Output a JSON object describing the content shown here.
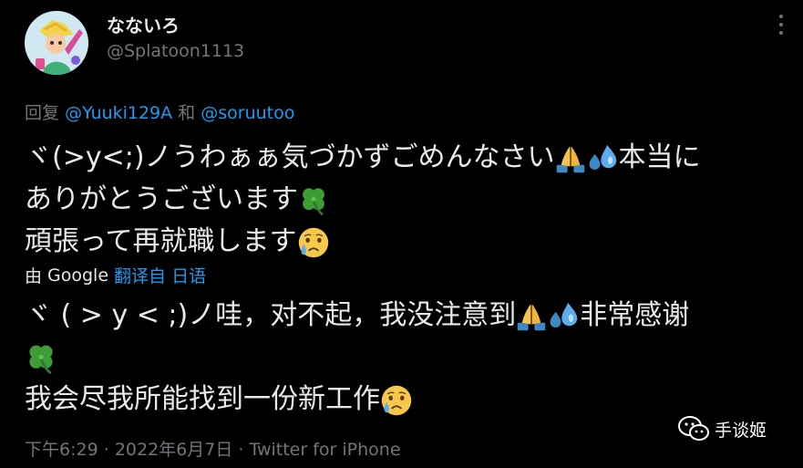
{
  "author": {
    "display_name": "なないろ",
    "handle": "@Splatoon1113"
  },
  "reply": {
    "prefix": "回复",
    "mention1": "@Yuuki129A",
    "conjunction": "和",
    "mention2": "@soruutoo"
  },
  "tweet": {
    "line1_a": "ヾ(>y<;)ノうわぁぁ気づかずごめんなさい",
    "line1_b": "本当に",
    "line2": "ありがとうございます",
    "line3": "頑張って再就職します"
  },
  "translation": {
    "by": "由",
    "google": "Google",
    "translated_from": "翻译自 日语",
    "line1_a": "ヾ ( > y < ;)ノ哇，对不起，我没注意到",
    "line1_b": "非常感谢",
    "line3": "我会尽我所能找到一份新工作"
  },
  "meta": {
    "time": "下午6:29",
    "separator1": "·",
    "date": "2022年6月7日",
    "separator2": "·",
    "source": "Twitter for iPhone"
  },
  "watermark": {
    "label": "手谈姬"
  },
  "icons": {
    "more": "more-icon",
    "pray": "folded-hands-emoji",
    "sweat": "sweat-droplets-emoji",
    "clover": "four-leaf-clover-emoji",
    "cry": "crying-face-emoji",
    "wechat": "wechat-icon"
  },
  "colors": {
    "background": "#000000",
    "text": "#e7e9ea",
    "secondary": "#71767b",
    "link": "#1d9bf0"
  }
}
